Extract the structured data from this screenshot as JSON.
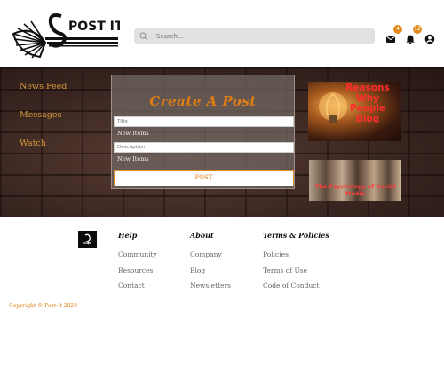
{
  "header": {
    "logo_text": "POST IT.",
    "search": {
      "placeholder": "Search..."
    },
    "mail_badge": "4",
    "notify_badge": "12",
    "icons": [
      "mail-icon",
      "bell-icon",
      "account-icon"
    ]
  },
  "sidebar": {
    "items": [
      {
        "label": "News Feed"
      },
      {
        "label": "Messages"
      },
      {
        "label": "Watch"
      }
    ]
  },
  "post_form": {
    "title": "Create A Post",
    "title_placeholder": "Title",
    "title_tagline": "New Items",
    "description_placeholder": "Description",
    "description_tagline": "New Items",
    "submit_label": "POST"
  },
  "ads": {
    "ad1_text": "Reasons Why People Blog",
    "ad2_text": "The Psychology of Social Media"
  },
  "footer": {
    "columns": [
      {
        "heading": "Help",
        "links": [
          "Community",
          "Resources",
          "Contact"
        ]
      },
      {
        "heading": "About",
        "links": [
          "Company",
          "Blog",
          "Newsletters"
        ]
      },
      {
        "heading": "Terms & Policies",
        "links": [
          "Policies",
          "Terms of Use",
          "Code of Conduct"
        ]
      }
    ],
    "copyright": "Copyright © Post-It 2020"
  },
  "colors": {
    "accent": "#e07d14",
    "sidebar_link": "#d99a3a",
    "badge": "#e48a1a"
  }
}
